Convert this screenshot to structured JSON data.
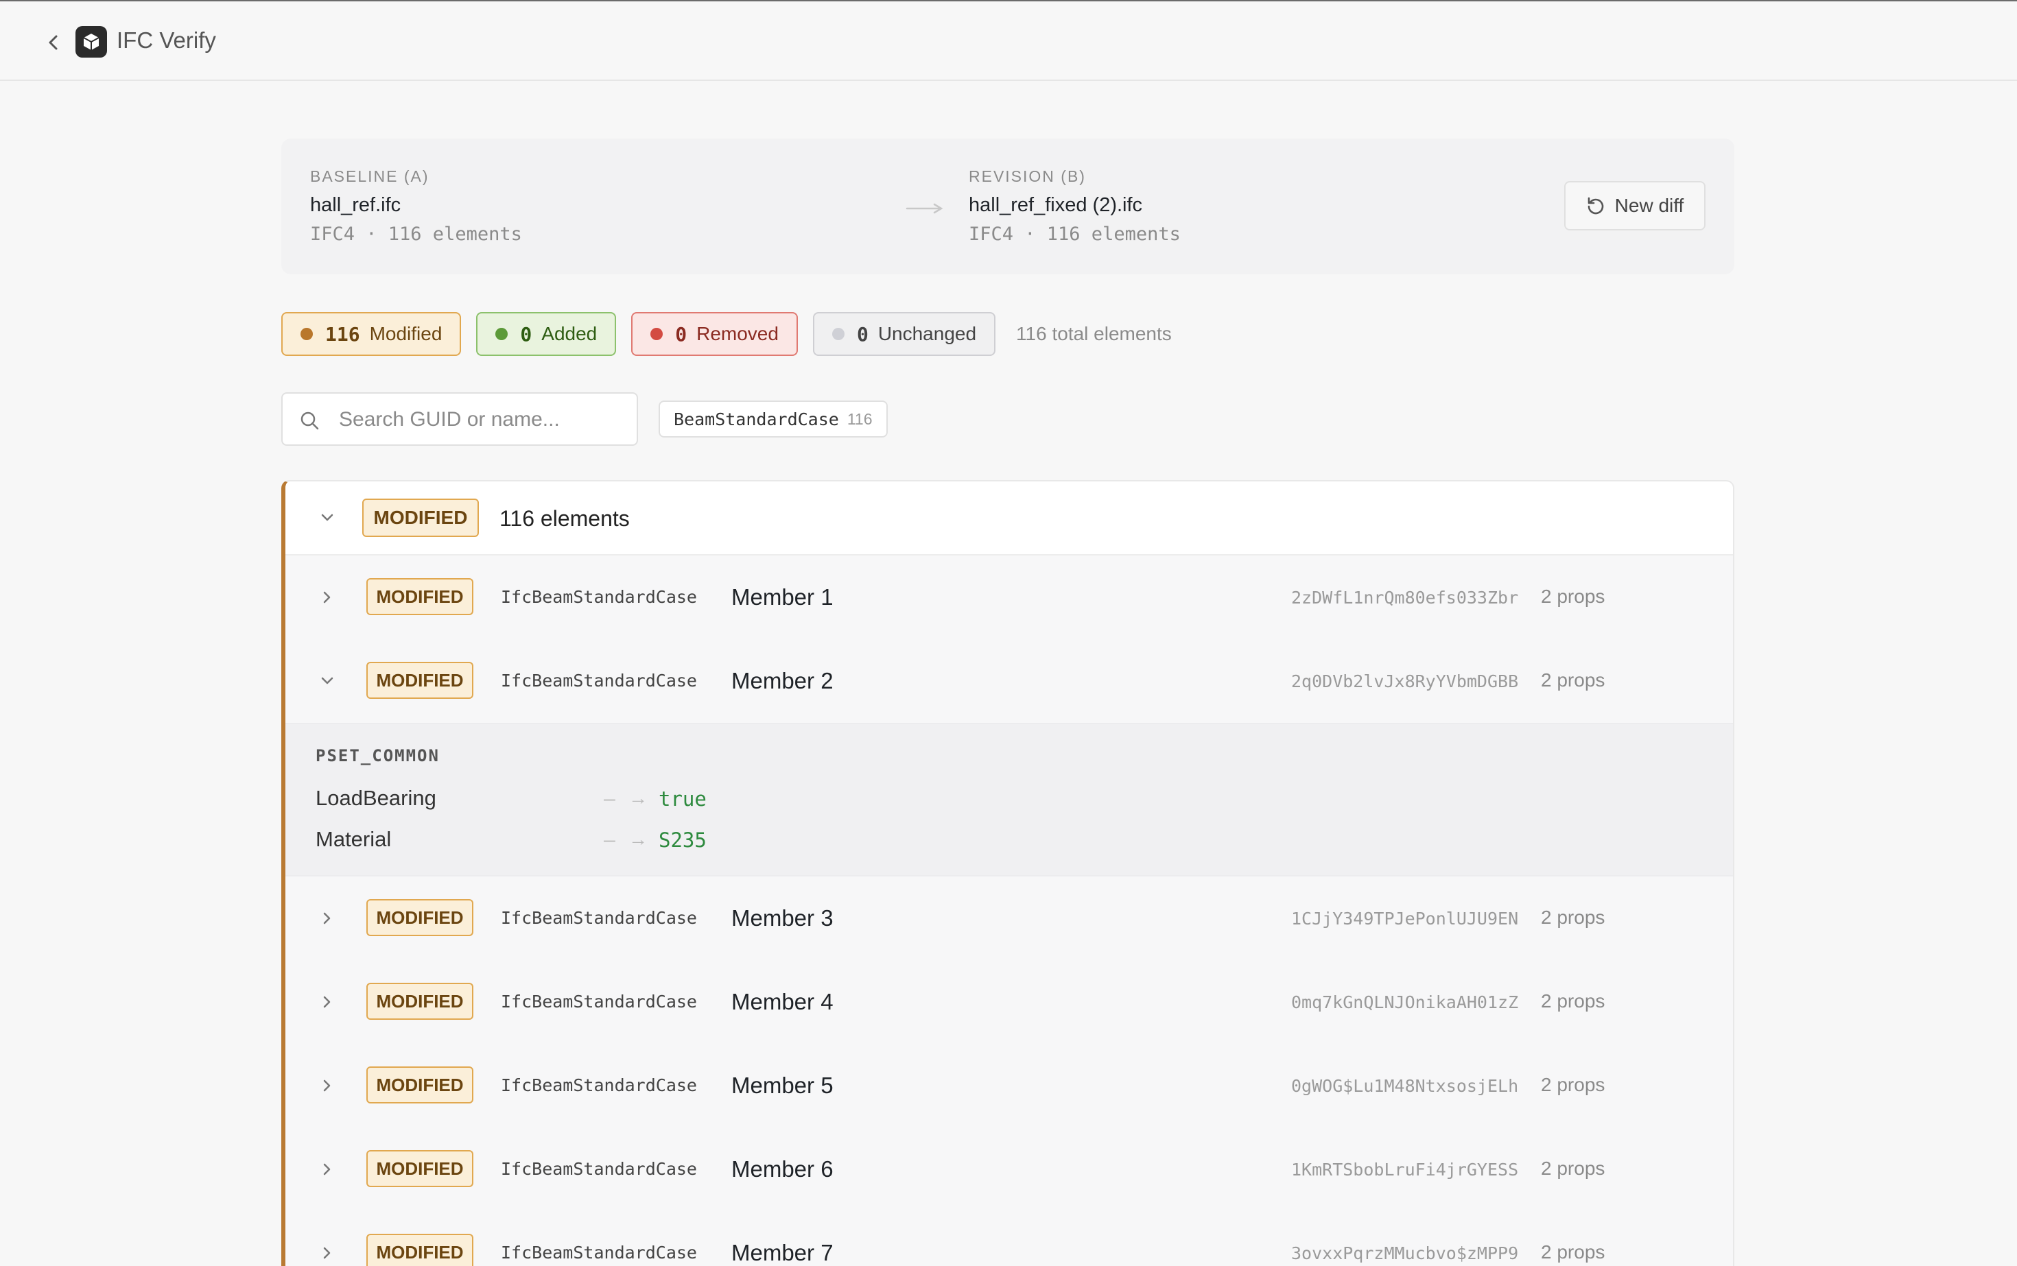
{
  "app": {
    "title": "IFC Verify"
  },
  "diff": {
    "baseline": {
      "label": "BASELINE (A)",
      "file": "hall_ref.ifc",
      "meta": "IFC4 · 116 elements"
    },
    "revision": {
      "label": "REVISION (B)",
      "file": "hall_ref_fixed (2).ifc",
      "meta": "IFC4 · 116 elements"
    },
    "new_diff_label": "New diff"
  },
  "summary": {
    "modified": {
      "count": "116",
      "label": "Modified"
    },
    "added": {
      "count": "0",
      "label": "Added"
    },
    "removed": {
      "count": "0",
      "label": "Removed"
    },
    "unchanged": {
      "count": "0",
      "label": "Unchanged"
    },
    "total_text": "116 total elements"
  },
  "search": {
    "placeholder": "Search GUID or name..."
  },
  "type_filter": {
    "name": "BeamStandardCase",
    "count": "116"
  },
  "group": {
    "status": "MODIFIED",
    "count_label": "116 elements",
    "items": [
      {
        "status": "MODIFIED",
        "ifc_type": "IfcBeamStandardCase",
        "name": "Member 1",
        "guid": "2zDWfL1nrQm80efs033Zbr",
        "props": "2 props",
        "expanded": false
      },
      {
        "status": "MODIFIED",
        "ifc_type": "IfcBeamStandardCase",
        "name": "Member 2",
        "guid": "2q0DVb2lvJx8RyYVbmDGBB",
        "props": "2 props",
        "expanded": true,
        "pset": {
          "name": "PSET_COMMON",
          "properties": [
            {
              "name": "LoadBearing",
              "old": "–",
              "new": "true"
            },
            {
              "name": "Material",
              "old": "–",
              "new": "S235"
            }
          ]
        }
      },
      {
        "status": "MODIFIED",
        "ifc_type": "IfcBeamStandardCase",
        "name": "Member 3",
        "guid": "1CJjY349TPJePonlUJU9EN",
        "props": "2 props",
        "expanded": false
      },
      {
        "status": "MODIFIED",
        "ifc_type": "IfcBeamStandardCase",
        "name": "Member 4",
        "guid": "0mq7kGnQLNJOnikaAH01zZ",
        "props": "2 props",
        "expanded": false
      },
      {
        "status": "MODIFIED",
        "ifc_type": "IfcBeamStandardCase",
        "name": "Member 5",
        "guid": "0gWOG$Lu1M48NtxsosjELh",
        "props": "2 props",
        "expanded": false
      },
      {
        "status": "MODIFIED",
        "ifc_type": "IfcBeamStandardCase",
        "name": "Member 6",
        "guid": "1KmRTSbobLruFi4jrGYESS",
        "props": "2 props",
        "expanded": false
      },
      {
        "status": "MODIFIED",
        "ifc_type": "IfcBeamStandardCase",
        "name": "Member 7",
        "guid": "3ovxxPqrzMMucbvo$zMPP9",
        "props": "2 props",
        "expanded": false
      }
    ]
  }
}
